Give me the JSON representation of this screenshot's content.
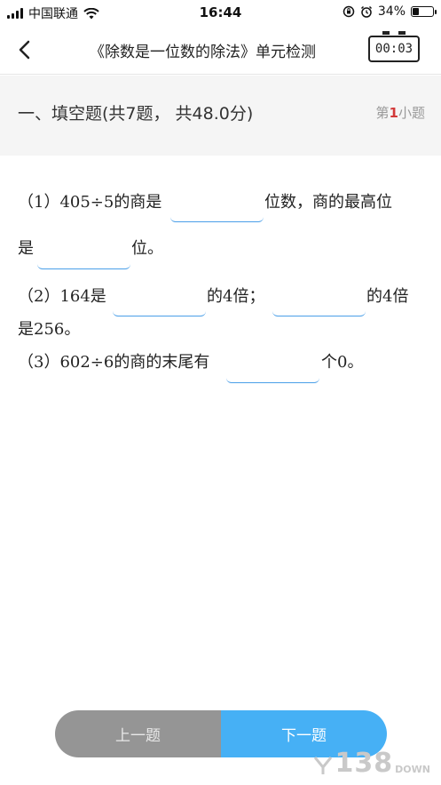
{
  "status_bar": {
    "carrier": "中国联通",
    "time": "16:44",
    "battery_percent": "34%",
    "battery_level": 0.34
  },
  "nav": {
    "title": "《除数是一位数的除法》单元检测",
    "timer": "00:03"
  },
  "section": {
    "title": "一、填空题(共7题， 共48.0分)",
    "counter_prefix": "第",
    "counter_num": "1",
    "counter_suffix": "小题"
  },
  "questions": {
    "q1_part1": "（1）405÷5的商是",
    "q1_part2": "位数，商的最高位",
    "q1_part3": "是",
    "q1_part4": "位。",
    "q2_part1": "（2）164是",
    "q2_part2": "的4倍；",
    "q2_part3": "的4倍",
    "q2_part4": "是256。",
    "q3_part1": "（3）602÷6的商的末尾有",
    "q3_part2": "个0。"
  },
  "buttons": {
    "prev": "上一题",
    "next": "下一题"
  },
  "watermark": {
    "number": "138",
    "suffix": "DOWN"
  }
}
